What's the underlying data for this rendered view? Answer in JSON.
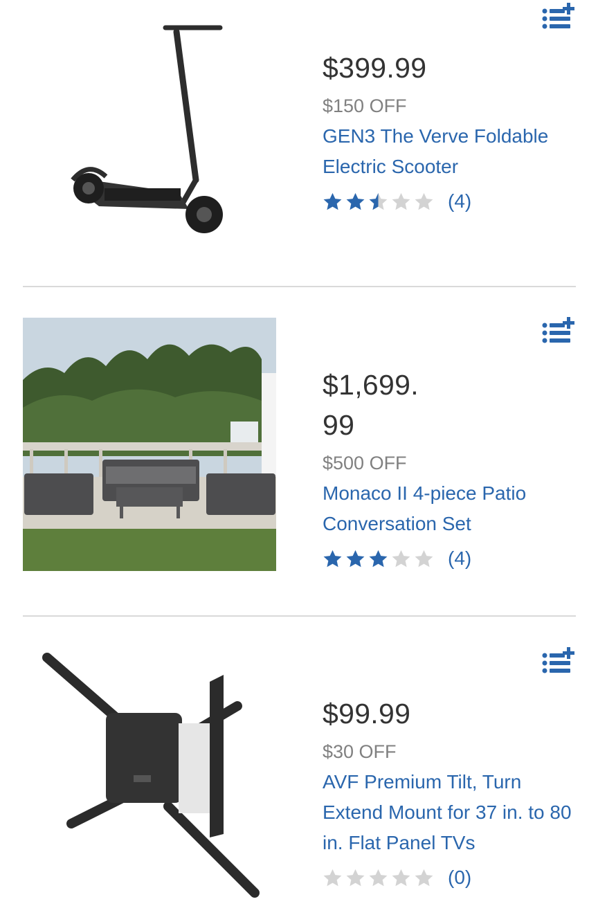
{
  "products": [
    {
      "price": "$399.99",
      "discount": "$150 OFF",
      "name": "GEN3 The Verve Foldable Electric Scooter",
      "rating": 2.5,
      "review_count": "(4)",
      "image": "electric-scooter",
      "icon": "add-to-list-icon"
    },
    {
      "price": "$1,699.\n99",
      "discount": "$500 OFF",
      "name": "Monaco II 4-piece Patio Conversation Set",
      "rating": 3,
      "review_count": "(4)",
      "image": "patio-set",
      "icon": "add-to-list-icon"
    },
    {
      "price": "$99.99",
      "discount": "$30 OFF",
      "name": "AVF Premium Tilt, Turn Extend Mount for 37 in. to 80 in. Flat Panel TVs",
      "rating": 0,
      "review_count": "(0)",
      "image": "tv-wall-mount",
      "icon": "add-to-list-icon"
    }
  ],
  "colors": {
    "link": "#2a66ad",
    "star_filled": "#2a66ad",
    "star_empty": "#d3d3d3",
    "price": "#333333",
    "discount": "#808080",
    "divider": "#d9d9d9"
  }
}
